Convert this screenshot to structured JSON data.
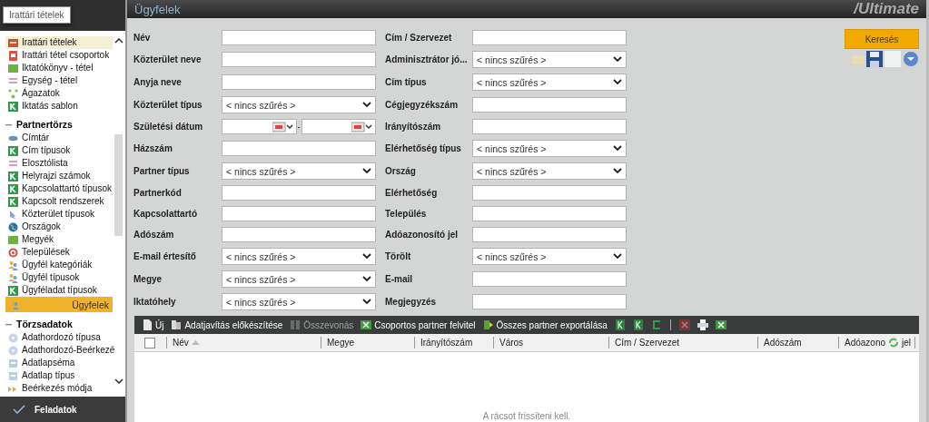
{
  "header": {
    "title": "Ügyfelek",
    "logo": "/Ultimate"
  },
  "tooltip": "Irattári tételek",
  "sidebar": {
    "groups": [
      {
        "items": [
          {
            "label": "Irattári tételek",
            "selected": false,
            "hovered": true
          },
          {
            "label": "Irattári tétel csoportok",
            "selected": false,
            "hovered": false
          },
          {
            "label": "Iktatókönyv - tétel",
            "selected": false,
            "hovered": false
          },
          {
            "label": "Egység - tétel",
            "selected": false,
            "hovered": false
          },
          {
            "label": "Ágazatok",
            "selected": false,
            "hovered": false
          },
          {
            "label": "Iktatás sablon",
            "selected": false,
            "hovered": false
          }
        ]
      },
      {
        "title": "Partnertörzs",
        "expanded": true,
        "items": [
          {
            "label": "Címtár",
            "selected": false,
            "hovered": false
          },
          {
            "label": "Cím típusok",
            "selected": false,
            "hovered": false
          },
          {
            "label": "Elosztólista",
            "selected": false,
            "hovered": false
          },
          {
            "label": "Helyrajzi számok",
            "selected": false,
            "hovered": false
          },
          {
            "label": "Kapcsolattartó típusok",
            "selected": false,
            "hovered": false
          },
          {
            "label": "Kapcsolt rendszerek",
            "selected": false,
            "hovered": false
          },
          {
            "label": "Közterület típusok",
            "selected": false,
            "hovered": false
          },
          {
            "label": "Országok",
            "selected": false,
            "hovered": false
          },
          {
            "label": "Megyék",
            "selected": false,
            "hovered": false
          },
          {
            "label": "Települések",
            "selected": false,
            "hovered": false
          },
          {
            "label": "Ügyfél kategóriák",
            "selected": false,
            "hovered": false
          },
          {
            "label": "Ügyfél típusok",
            "selected": false,
            "hovered": false
          },
          {
            "label": "Ügyféladat típusok",
            "selected": false,
            "hovered": false
          },
          {
            "label": "Ügyfelek",
            "selected": true,
            "hovered": false
          }
        ]
      },
      {
        "title": "Törzsadatok",
        "expanded": true,
        "items": [
          {
            "label": "Adathordozó típusa",
            "selected": false,
            "hovered": false
          },
          {
            "label": "Adathordozó-Beérkezé",
            "selected": false,
            "hovered": false
          },
          {
            "label": "Adatlapséma",
            "selected": false,
            "hovered": false
          },
          {
            "label": "Adatlap típus",
            "selected": false,
            "hovered": false
          },
          {
            "label": "Beérkezés módja",
            "selected": false,
            "hovered": false
          }
        ]
      }
    ],
    "footer_button": "Feladatok"
  },
  "form": {
    "fields": [
      {
        "label": "Név",
        "kind": "text"
      },
      {
        "label": "Cím / Szervezet",
        "kind": "text"
      },
      {
        "label": "Közterület neve",
        "kind": "text"
      },
      {
        "label": "Adminisztrátor jó...",
        "kind": "select",
        "value": "< nincs szűrés >"
      },
      {
        "label": "Anyja neve",
        "kind": "text"
      },
      {
        "label": "Cím típus",
        "kind": "select",
        "value": "< nincs szűrés >"
      },
      {
        "label": "Közterület típus",
        "kind": "select",
        "value": "< nincs szűrés >"
      },
      {
        "label": "Cégjegyzékszám",
        "kind": "text"
      },
      {
        "label": "Születési dátum",
        "kind": "date-range",
        "separator": "-"
      },
      {
        "label": "Irányítószám",
        "kind": "text"
      },
      {
        "label": "Házszám",
        "kind": "text"
      },
      {
        "label": "Elérhetőség típus",
        "kind": "select",
        "value": "< nincs szűrés >"
      },
      {
        "label": "Partner típus",
        "kind": "select",
        "value": "< nincs szűrés >"
      },
      {
        "label": "Ország",
        "kind": "select",
        "value": "< nincs szűrés >"
      },
      {
        "label": "Partnerkód",
        "kind": "text"
      },
      {
        "label": "Elérhetőség",
        "kind": "text"
      },
      {
        "label": "Kapcsolattartó",
        "kind": "text"
      },
      {
        "label": "Település",
        "kind": "text"
      },
      {
        "label": "Adószám",
        "kind": "text"
      },
      {
        "label": "Adóazonosító jel",
        "kind": "text"
      },
      {
        "label": "E-mail értesítő",
        "kind": "select",
        "value": "< nincs szűrés >"
      },
      {
        "label": "Törölt",
        "kind": "select",
        "value": "< nincs szűrés >"
      },
      {
        "label": "Megye",
        "kind": "select",
        "value": "< nincs szűrés >"
      },
      {
        "label": "E-mail",
        "kind": "text"
      },
      {
        "label": "Iktatóhely",
        "kind": "select",
        "value": "< nincs szűrés >"
      },
      {
        "label": "Megjegyzés",
        "kind": "text"
      }
    ],
    "search_button": "Keresés"
  },
  "grid": {
    "toolbar": [
      {
        "kind": "button",
        "label": "Új",
        "disabled": false
      },
      {
        "kind": "button",
        "label": "Adatjavítás előkészítése",
        "disabled": false
      },
      {
        "kind": "button",
        "label": "Összevonás",
        "disabled": true
      },
      {
        "kind": "button",
        "label": "Csoportos partner felvitel",
        "disabled": false
      },
      {
        "kind": "button",
        "label": "Összes partner exportálása",
        "disabled": false
      },
      {
        "kind": "icon-button",
        "disabled": false
      },
      {
        "kind": "icon-button",
        "disabled": false
      },
      {
        "kind": "icon-button",
        "disabled": false
      },
      {
        "kind": "separator"
      },
      {
        "kind": "icon-button",
        "disabled": true
      },
      {
        "kind": "icon-button",
        "disabled": false
      },
      {
        "kind": "icon-button",
        "disabled": false
      }
    ],
    "select_all": {
      "checked": false
    },
    "columns": [
      {
        "label": "Név",
        "sorted": true,
        "loading": false
      },
      {
        "label": "Megye",
        "sorted": false,
        "loading": false
      },
      {
        "label": "Irányítószám",
        "sorted": false,
        "loading": false
      },
      {
        "label": "Város",
        "sorted": false,
        "loading": false
      },
      {
        "label": "Cím / Szervezet",
        "sorted": false,
        "loading": false
      },
      {
        "label": "Adószám",
        "sorted": false,
        "loading": false
      },
      {
        "label": "Adóazono",
        "label_after": "jel",
        "sorted": false,
        "loading": true
      }
    ],
    "empty_message": "A rácsot frissíteni kell."
  }
}
